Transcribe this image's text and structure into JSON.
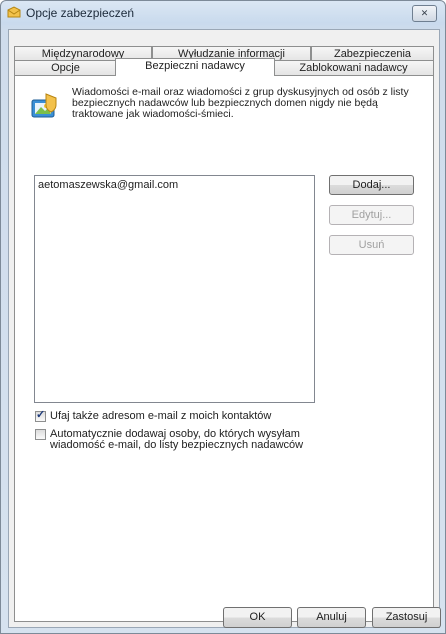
{
  "window": {
    "title": "Opcje zabezpieczeń",
    "close_glyph": "✕"
  },
  "tabs": {
    "row1": [
      "Międzynarodowy",
      "Wyłudzanie informacji",
      "Zabezpieczenia"
    ],
    "row2": [
      "Opcje",
      "Bezpieczni nadawcy",
      "Zablokowani nadawcy"
    ],
    "active": "Bezpieczni nadawcy"
  },
  "info": {
    "text": "Wiadomości e-mail oraz wiadomości z grup dyskusyjnych od osób z listy bezpiecznych nadawców lub bezpiecznych domen nigdy nie będą traktowane jak wiadomości-śmieci.",
    "icon": "safe-senders-icon"
  },
  "list": {
    "items": [
      "aetomaszewska@gmail.com"
    ]
  },
  "side_buttons": {
    "add": "Dodaj...",
    "edit": "Edytuj...",
    "remove": "Usuń"
  },
  "options": {
    "trust_contacts": {
      "label": "Ufaj także adresom e-mail z moich kontaktów",
      "checked": true
    },
    "auto_add": {
      "label_line1": "Automatycznie dodawaj osoby, do których wysyłam",
      "label_line2": "wiadomość e-mail, do listy bezpiecznych nadawców",
      "checked": false
    }
  },
  "footer": {
    "ok": "OK",
    "cancel": "Anuluj",
    "apply": "Zastosuj"
  }
}
